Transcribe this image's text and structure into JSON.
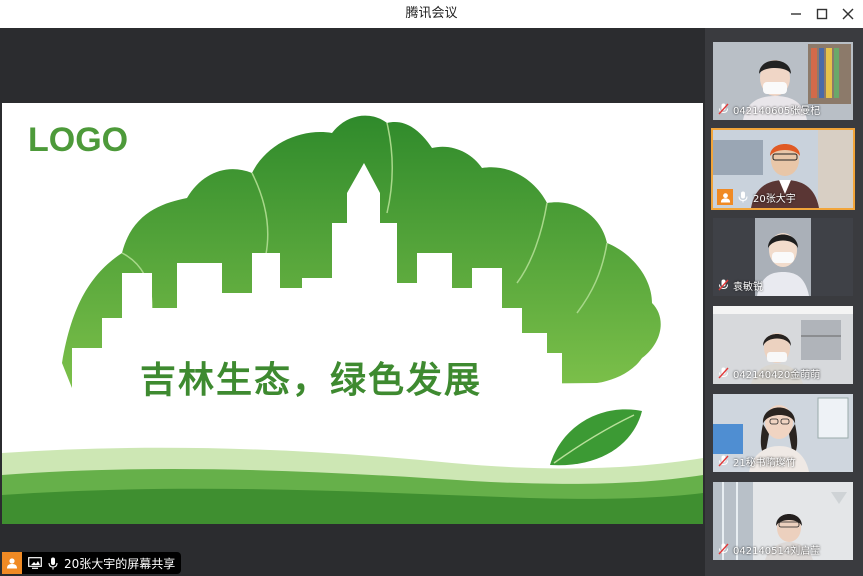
{
  "window": {
    "title": "腾讯会议"
  },
  "slide": {
    "logo": "LOGO",
    "slogan": "吉林生态，绿色发展"
  },
  "share": {
    "label": "20张大宇的屏幕共享"
  },
  "participants": [
    {
      "name": "042140605张曼杞",
      "shirt": "#e9e6ea",
      "active": false
    },
    {
      "name": "20张大宇",
      "shirt": "#5a3634",
      "active": true
    },
    {
      "name": "袁敏锐",
      "shirt": "#e9eaf0",
      "active": false
    },
    {
      "name": "042140420金萌萌",
      "shirt": "#d9d6d0",
      "active": false
    },
    {
      "name": "21秘书隋璨竹",
      "shirt": "#efe9e5",
      "active": false
    },
    {
      "name": "042140514刘启莹",
      "shirt": "#dcd8d6",
      "active": false
    }
  ],
  "colors": {
    "brand_green": "#4d9a3a",
    "speaking_orange": "#f08a24"
  }
}
